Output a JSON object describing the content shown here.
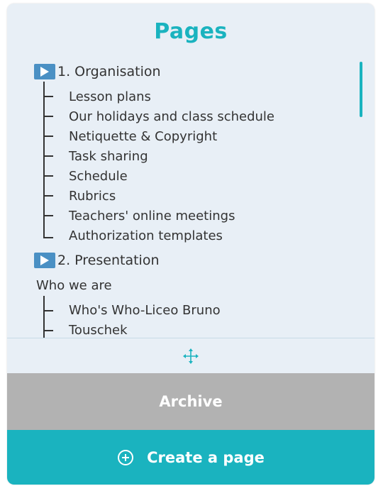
{
  "header": {
    "title": "Pages"
  },
  "sections": [
    {
      "label": "1. Organisation",
      "pages": [
        "Lesson plans",
        "Our holidays and class schedule",
        "Netiquette & Copyright",
        "Task sharing",
        "Schedule",
        "Rubrics",
        "Teachers' online meetings",
        "Authorization templates"
      ]
    },
    {
      "label": "2. Presentation",
      "subheading": "Who we are",
      "pages": [
        "Who's Who-Liceo Bruno",
        "Touschek"
      ]
    }
  ],
  "footer": {
    "archive_label": "Archive",
    "create_label": "Create a page"
  },
  "colors": {
    "accent": "#1ab3bf",
    "panel_bg": "#e8eff6",
    "archive_bg": "#b2b2b2",
    "play_icon": "#4a90c4"
  },
  "icons": {
    "section": "play-icon",
    "move": "move-arrows-icon",
    "create": "plus-circle-icon"
  }
}
